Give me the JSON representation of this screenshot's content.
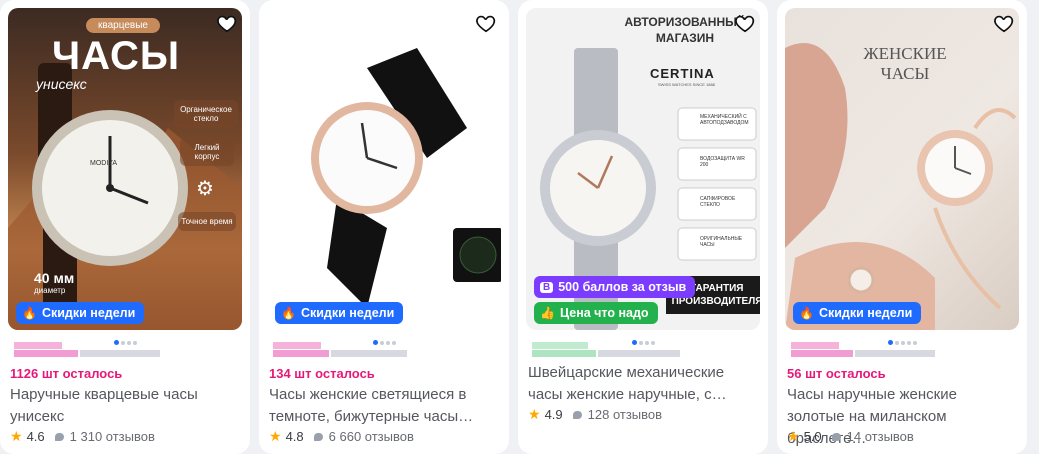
{
  "cards": [
    {
      "left_text": "1126 шт осталось",
      "title": "Наручные кварцевые часы унисекс",
      "rating": "4.6",
      "reviews": "1 310 отзывов",
      "badges": [
        "Скидки недели"
      ],
      "image_text": {
        "tag": "кварцевые",
        "headline": "ЧАСЫ",
        "sub": "унисекс",
        "features": [
          "Органическое стекло",
          "Легкий корпус",
          "Точное время"
        ],
        "size": "40 мм",
        "size_label": "диаметр",
        "dial_brand": "MODIYA"
      }
    },
    {
      "left_text": "134 шт осталось",
      "title": "Часы женские светящиеся в темноте, бижутерные часы…",
      "rating": "4.8",
      "reviews": "6 660 отзывов",
      "badges": [
        "Скидки недели"
      ]
    },
    {
      "left_text": "",
      "title": "Швейцарские механические часы женские наручные, с…",
      "rating": "4.9",
      "reviews": "128 отзывов",
      "badges": [
        "500 баллов за отзыв",
        "Цена что надо"
      ],
      "image_text": {
        "headline": "АВТОРИЗОВАННЫЙ МАГАЗИН",
        "brand": "CERTINA",
        "brand_sub": "SWISS WATCHES SINCE 1888",
        "features": [
          "МЕХАНИЧЕСКИЙ С АВТОПОДЗАВОДОМ",
          "ВОДОЗАЩИТА WR 200",
          "САПФИРОВОЕ СТЕКЛО",
          "ОРИГИНАЛЬНЫЕ ЧАСЫ"
        ],
        "guarantee": "ГАРАНТИЯ ПРОИЗВОДИТЕЛЯ"
      }
    },
    {
      "left_text": "56 шт осталось",
      "title": "Часы наручные женские золотые на миланском браслете…",
      "rating": "5.0",
      "reviews": "14 отзывов",
      "badges": [
        "Скидки недели"
      ],
      "image_text": {
        "headline": "ЖЕНСКИЕ ЧАСЫ"
      }
    }
  ],
  "colors": {
    "accent": "#1f6bff",
    "stock": "#e6197a",
    "star": "#ffa800"
  }
}
